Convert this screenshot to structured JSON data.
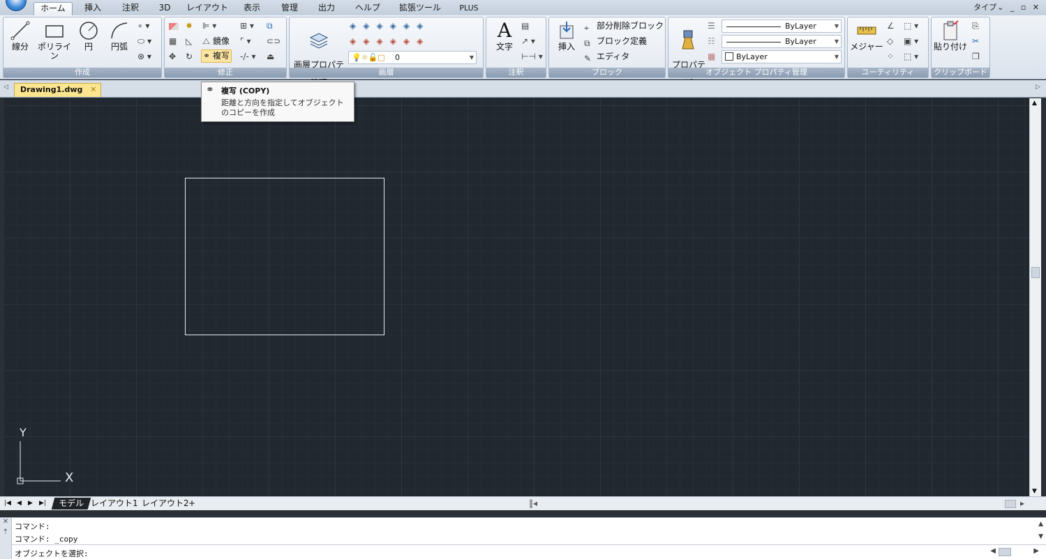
{
  "menu": {
    "tabs": [
      "ホーム",
      "挿入",
      "注釈",
      "3D",
      "レイアウト",
      "表示",
      "管理",
      "出力",
      "ヘルプ",
      "拡張ツール",
      "PLUS"
    ],
    "active_tab": "ホーム",
    "right_label": "タイプ",
    "win_controls": [
      "_",
      "▫",
      "✕"
    ]
  },
  "ribbon": {
    "draw": {
      "title": "作成",
      "line": "線分",
      "polyline": "ポリライン",
      "circle": "円",
      "arc": "円弧"
    },
    "modify": {
      "title": "修正",
      "mirror": "鏡像",
      "copy": "複写"
    },
    "layers": {
      "title": "画層",
      "manager": "画層プロパティ\n管理",
      "current_layer": "0"
    },
    "annotation": {
      "title": "注釈",
      "text": "文字"
    },
    "block": {
      "title": "ブロック",
      "insert": "挿入",
      "partial_delete": "部分削除ブロック",
      "define": "ブロック定義",
      "editor": "エディタ"
    },
    "properties": {
      "title": "オブジェクト プロパティ管理",
      "match": "プロパティ\nコピー",
      "linetype": "ByLayer",
      "lineweight": "ByLayer",
      "color": "ByLayer"
    },
    "utilities": {
      "title": "ユーティリティ",
      "measure": "メジャー"
    },
    "clipboard": {
      "title": "クリップボード",
      "paste": "貼り付け"
    }
  },
  "document": {
    "tab_name": "Drawing1.dwg",
    "close_glyph": "✕"
  },
  "tooltip": {
    "title": "複写 (COPY)",
    "description": "距離と方向を指定してオブジェクトのコピーを作成"
  },
  "ucs": {
    "x_label": "X",
    "y_label": "Y"
  },
  "layout_tabs": {
    "nav": [
      "|◀",
      "◀",
      "▶",
      "▶|"
    ],
    "tabs": [
      "モデル",
      "レイアウト1",
      "レイアウト2",
      "+"
    ],
    "active": "モデル"
  },
  "command": {
    "history": [
      "コマンド:",
      "コマンド:  _copy"
    ],
    "prompt": "オブジェクトを選択:"
  }
}
